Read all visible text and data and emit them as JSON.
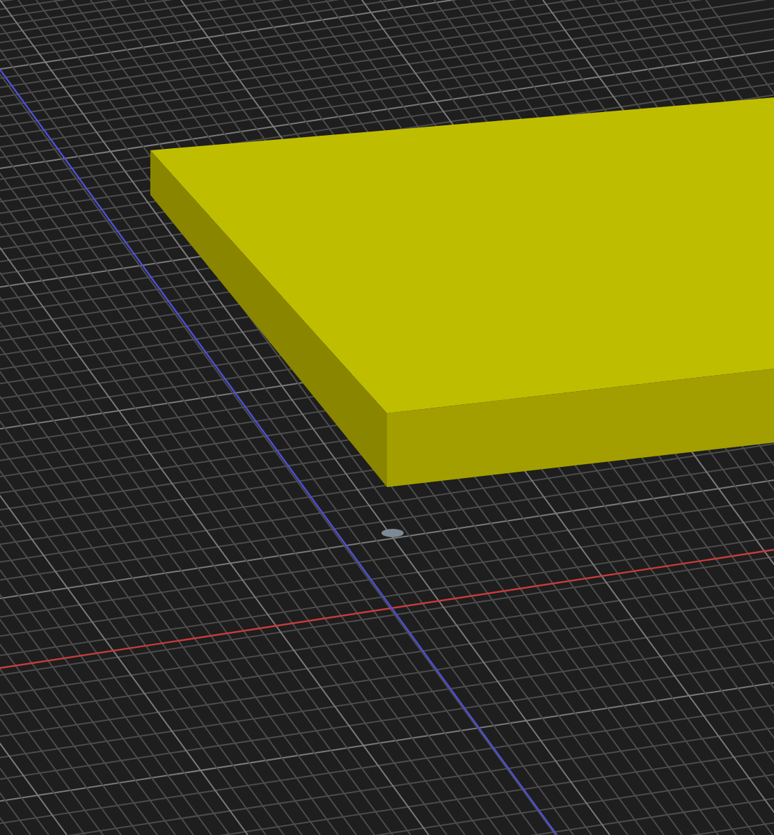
{
  "viewport": {
    "objects": [
      {
        "kind": "box"
      }
    ]
  }
}
